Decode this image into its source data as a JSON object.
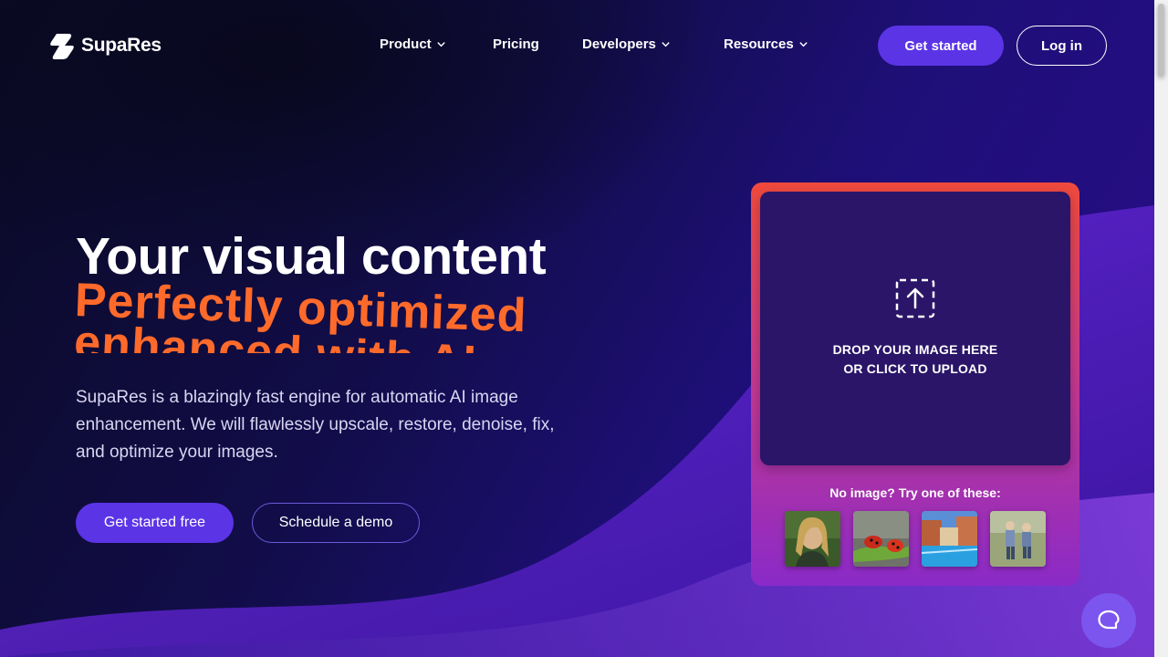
{
  "brand": {
    "name": "SupaRes"
  },
  "nav": {
    "items": [
      {
        "label": "Product",
        "has_dropdown": true
      },
      {
        "label": "Pricing",
        "has_dropdown": false
      },
      {
        "label": "Developers",
        "has_dropdown": true
      },
      {
        "label": "Resources",
        "has_dropdown": true
      }
    ],
    "cta_primary": "Get started",
    "cta_login": "Log in"
  },
  "hero": {
    "title": "Your visual content",
    "rotating_lines": [
      "Perfectly optimized",
      "enhanced with AI"
    ],
    "description": "SupaRes is a blazingly fast engine for automatic AI image enhancement. We will flawlessly upscale, restore, denoise, fix, and optimize your images.",
    "primary_button": "Get started free",
    "secondary_button": "Schedule a demo"
  },
  "upload": {
    "drop_line1": "DROP YOUR IMAGE HERE",
    "drop_line2": "OR CLICK TO UPLOAD",
    "samples_label": "No image? Try one of these:",
    "samples": [
      "portrait-sample",
      "ladybug-sample",
      "pool-village-sample",
      "children-walking-sample"
    ]
  },
  "colors": {
    "accent": "#5b34e6",
    "highlight": "#ff6a2b",
    "card_top": "#f04a3c",
    "card_bottom": "#8a2ac8",
    "drop_zone": "#2a1568"
  }
}
